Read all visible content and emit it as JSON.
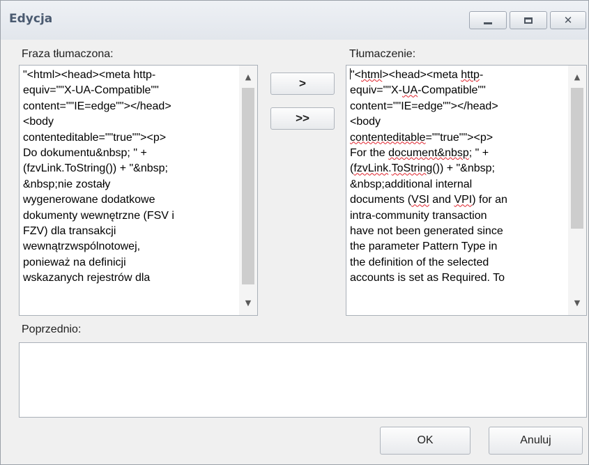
{
  "window": {
    "title": "Edycja"
  },
  "source": {
    "label": "Fraza tłumaczona:",
    "text": "\"<html><head><meta http-\nequiv=\"\"X-UA-Compatible\"\"\ncontent=\"\"IE=edge\"\"></head>\n<body\ncontenteditable=\"\"true\"\"><p>\nDo dokumentu&nbsp; \" +\n(fzvLink.ToString()) + \"&nbsp;\n&nbsp;nie zostały\nwygenerowane dodatkowe\ndokumenty wewnętrzne (FSV i\nFZV) dla transakcji\nwewnątrzwspólnotowej,\nponieważ na definicji\nwskazanych rejestrów dla"
  },
  "buttons": {
    "copy": ">",
    "copy_all": ">>",
    "ok": "OK",
    "cancel": "Anuluj"
  },
  "translation": {
    "label": "Tłumaczenie:",
    "lines": [
      [
        "\"<",
        {
          "s": "html"
        },
        "><head><meta ",
        {
          "s": "http"
        },
        "-"
      ],
      [
        "equiv=\"\"X-",
        {
          "s": "UA"
        },
        "-Compatible\"\""
      ],
      [
        "content=\"\"IE=edge\"\"></head>"
      ],
      [
        "<body"
      ],
      [
        {
          "s": "contenteditable"
        },
        "=\"\"true\"\"><p>"
      ],
      [
        "For the ",
        {
          "s": "document&nbsp"
        },
        "; \" +"
      ],
      [
        "(",
        {
          "s": "fzvLink"
        },
        ".",
        {
          "s": "ToString"
        },
        "()) + \"&nbsp;"
      ],
      [
        "&nbsp;additional internal"
      ],
      [
        "documents (",
        {
          "s": "VSI"
        },
        " and ",
        {
          "s": "VPI"
        },
        ") for an"
      ],
      [
        "intra-community transaction"
      ],
      [
        "have not been generated since"
      ],
      [
        "the parameter Pattern Type in"
      ],
      [
        "the definition of the selected"
      ],
      [
        "accounts is set as Required. To"
      ]
    ]
  },
  "previous": {
    "label": "Poprzednio:",
    "text": ""
  },
  "icons": {
    "minimize": "minimize-icon",
    "maximize": "maximize-icon",
    "close": "close-icon",
    "scroll_up": "chevron-up-icon",
    "scroll_down": "chevron-down-icon"
  },
  "colors": {
    "spellcheck": "#e0202a",
    "title": "#4a5a70"
  }
}
